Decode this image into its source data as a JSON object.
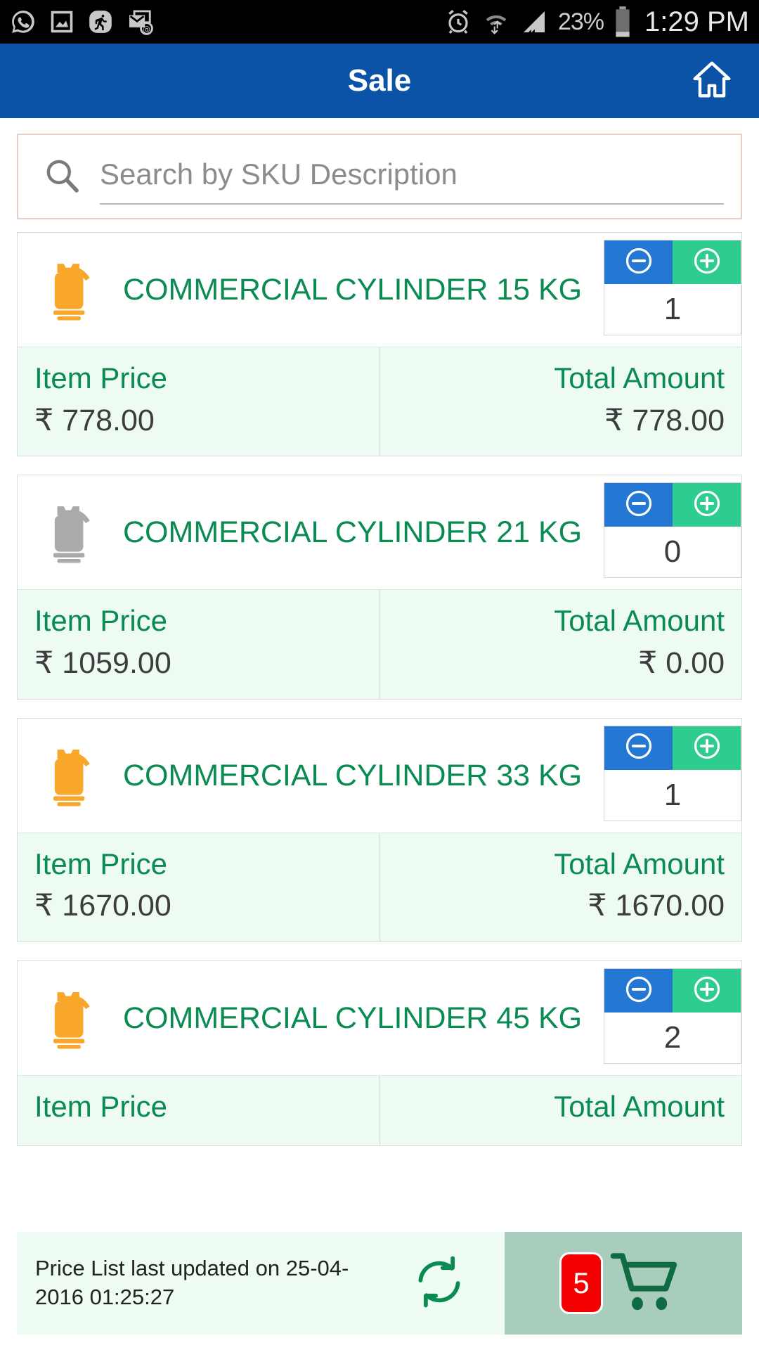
{
  "status_bar": {
    "left_icons": [
      "whatsapp-icon",
      "screenshot-icon",
      "fitness-run-icon",
      "email-sync-icon"
    ],
    "right_icons": [
      "alarm-icon",
      "wifi-data-icon",
      "signal-bars-icon"
    ],
    "battery_percent": "23%",
    "time": "1:29 PM"
  },
  "app_bar": {
    "title": "Sale",
    "home_icon": "home-icon"
  },
  "search": {
    "placeholder": "Search by SKU Description",
    "value": "",
    "icon": "search-icon"
  },
  "products": [
    {
      "name": "COMMERCIAL CYLINDER 15 KG",
      "icon": "gas-cylinder-icon",
      "icon_state": "active",
      "quantity": "1",
      "item_price_label": "Item Price",
      "item_price": "₹ 778.00",
      "total_label": "Total Amount",
      "total_amount": "₹ 778.00"
    },
    {
      "name": "COMMERCIAL CYLINDER 21 KG",
      "icon": "gas-cylinder-icon",
      "icon_state": "inactive",
      "quantity": "0",
      "item_price_label": "Item Price",
      "item_price": "₹ 1059.00",
      "total_label": "Total Amount",
      "total_amount": "₹ 0.00"
    },
    {
      "name": "COMMERCIAL CYLINDER 33 KG",
      "icon": "gas-cylinder-icon",
      "icon_state": "active",
      "quantity": "1",
      "item_price_label": "Item Price",
      "item_price": "₹ 1670.00",
      "total_label": "Total Amount",
      "total_amount": "₹ 1670.00"
    },
    {
      "name": "COMMERCIAL CYLINDER 45 KG",
      "icon": "gas-cylinder-icon",
      "icon_state": "active",
      "quantity": "2",
      "item_price_label": "Item Price",
      "item_price": "",
      "total_label": "Total Amount",
      "total_amount": ""
    }
  ],
  "stepper": {
    "minus_icon": "minus-circle-icon",
    "plus_icon": "plus-circle-icon"
  },
  "footer": {
    "price_list_text": "Price List last updated on 25-04-2016 01:25:27",
    "refresh_icon": "refresh-icon",
    "cart_icon": "shopping-cart-icon",
    "cart_count": "5"
  },
  "colors": {
    "app_bar": "#0b53a6",
    "brand_green": "#0a8b52",
    "minus_blue": "#2478d4",
    "plus_green": "#2ecc8f",
    "cylinder_orange": "#f9a72b",
    "cylinder_grey": "#aaaaaa",
    "badge_red": "#f50000",
    "price_row_bg": "#edfbf3",
    "cart_panel_bg": "#a8cdbd"
  }
}
